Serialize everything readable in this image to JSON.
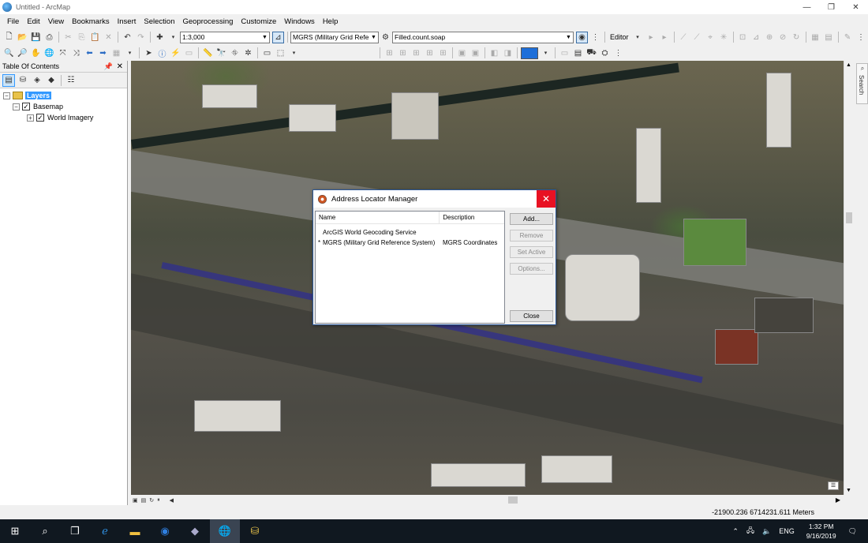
{
  "window": {
    "title": "Untitled - ArcMap",
    "minimize": "—",
    "maximize": "❐",
    "close": "✕"
  },
  "menu": [
    "File",
    "Edit",
    "View",
    "Bookmarks",
    "Insert",
    "Selection",
    "Geoprocessing",
    "Customize",
    "Windows",
    "Help"
  ],
  "toolbar": {
    "scale": "1:3,000",
    "locator": "MGRS (Military Grid Refere",
    "address": "Filled.count.soap",
    "editor": "Editor"
  },
  "toc": {
    "title": "Table Of Contents",
    "pin": "ᵖ",
    "close": "✕",
    "layers": "Layers",
    "basemap": "Basemap",
    "world_imagery": "World Imagery"
  },
  "map": {
    "search_tab": "Search"
  },
  "status": {
    "coords": "-21900.236  6714231.611 Meters"
  },
  "dialog": {
    "title": "Address Locator Manager",
    "close": "✕",
    "columns": [
      "Name",
      "Description"
    ],
    "rows": [
      {
        "marker": "",
        "name": "ArcGIS World Geocoding Service",
        "description": ""
      },
      {
        "marker": "*",
        "name": "MGRS (Military Grid Reference System)",
        "description": "MGRS Coordinates"
      }
    ],
    "buttons": {
      "add": "Add...",
      "remove": "Remove",
      "set_active": "Set Active",
      "options": "Options...",
      "close": "Close"
    }
  },
  "taskbar": {
    "language": "ENG",
    "time": "1:32 PM",
    "date": "9/16/2019"
  }
}
